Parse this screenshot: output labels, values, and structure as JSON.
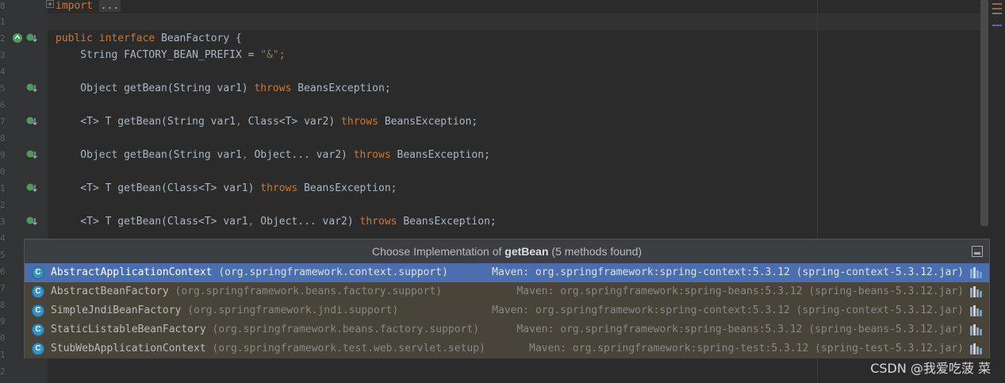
{
  "editor": {
    "line_numbers": [
      "8",
      "1",
      "2",
      "3",
      "4",
      "5",
      "6",
      "7",
      "8",
      "9",
      "0",
      "1",
      "2",
      "3",
      "4",
      "5",
      "6",
      "7",
      "8",
      "9",
      "0",
      "1",
      "2"
    ],
    "lines": {
      "l1_import": "import",
      "l1_fold": "...",
      "l4_public": "public",
      "l4_interface": "interface",
      "l4_name": " BeanFactory {",
      "l5_decl": "    String FACTORY_BEAN_PREFIX = ",
      "l5_str": "\"&\"",
      "l5_end": ";",
      "l7_a": "    Object getBean(String var1) ",
      "l7_throws": "throws",
      "l7_b": " BeansException;",
      "l9_a": "    <T> T getBean(String var1",
      "l9_comma": ",",
      "l9_b": " Class<T> var2) ",
      "l9_throws": "throws",
      "l9_c": " BeansException;",
      "l11_a": "    Object getBean(String var1",
      "l11_comma": ",",
      "l11_b": " Object... var2) ",
      "l11_throws": "throws",
      "l11_c": " BeansException;",
      "l13_a": "    <T> T getBean(Class<T> var1) ",
      "l13_throws": "throws",
      "l13_b": " BeansException;",
      "l15_a": "    <T> T getBean(Class<T> var1",
      "l15_comma": ",",
      "l15_b": " Object... var2) ",
      "l15_throws": "throws",
      "l15_c": " BeansException;"
    }
  },
  "popup": {
    "title_prefix": "Choose Implementation of ",
    "title_method": "getBean",
    "title_suffix": " (5 methods found)",
    "items": [
      {
        "icon": "C",
        "name": "AbstractApplicationContext",
        "package": "(org.springframework.context.support)",
        "maven": "Maven: org.springframework:spring-context:5.3.12 (spring-context-5.3.12.jar)"
      },
      {
        "icon": "C",
        "name": "AbstractBeanFactory",
        "package": "(org.springframework.beans.factory.support)",
        "maven": "Maven: org.springframework:spring-beans:5.3.12 (spring-beans-5.3.12.jar)"
      },
      {
        "icon": "C",
        "name": "SimpleJndiBeanFactory",
        "package": "(org.springframework.jndi.support)",
        "maven": "Maven: org.springframework:spring-context:5.3.12 (spring-context-5.3.12.jar)"
      },
      {
        "icon": "C",
        "name": "StaticListableBeanFactory",
        "package": "(org.springframework.beans.factory.support)",
        "maven": "Maven: org.springframework:spring-beans:5.3.12 (spring-beans-5.3.12.jar)"
      },
      {
        "icon": "C",
        "name": "StubWebApplicationContext",
        "package": "(org.springframework.test.web.servlet.setup)",
        "maven": "Maven: org.springframework:spring-test:5.3.12 (spring-test-5.3.12.jar)"
      }
    ],
    "selected_index": 0
  },
  "watermark": "CSDN @我爱吃菠 菜",
  "colors": {
    "background": "#2b2b2b",
    "keyword": "#cc7832",
    "string": "#6a8759",
    "selection": "#4b6eaf",
    "implementation_icon": "#4e9a5e"
  }
}
